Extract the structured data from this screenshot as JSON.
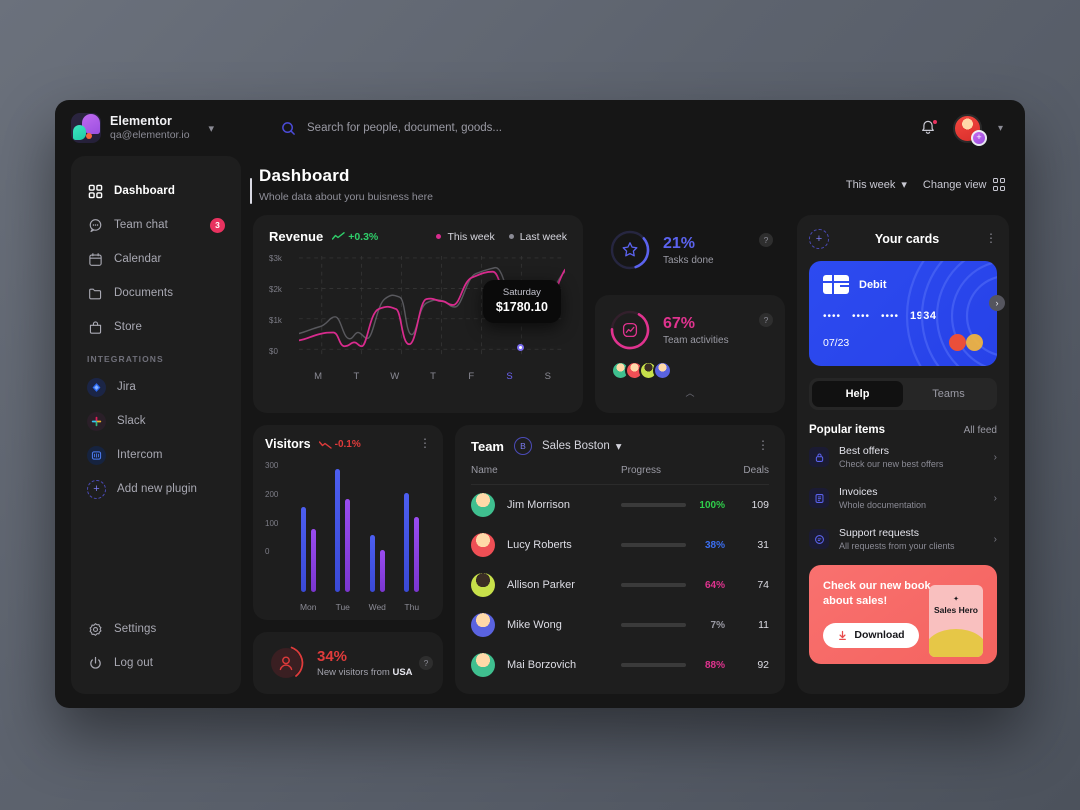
{
  "brand": {
    "name": "Elementor",
    "email": "qa@elementor.io",
    "caret": "▾"
  },
  "search": {
    "placeholder": "Search for people, document, goods...",
    "value": "",
    "icon": "search-icon"
  },
  "topbar": {
    "bell_icon": "bell-icon",
    "avatar_badge": "+",
    "chevron": "▾"
  },
  "sidebar": {
    "items": [
      {
        "label": "Dashboard",
        "icon": "grid-icon",
        "badge": ""
      },
      {
        "label": "Team chat",
        "icon": "chat-icon",
        "badge": "3"
      },
      {
        "label": "Calendar",
        "icon": "calendar-icon",
        "badge": ""
      },
      {
        "label": "Documents",
        "icon": "folder-icon",
        "badge": ""
      },
      {
        "label": "Store",
        "icon": "bag-icon",
        "badge": ""
      }
    ],
    "section_title": "INTEGRATIONS",
    "integrations": [
      {
        "label": "Jira",
        "icon": "jira-icon"
      },
      {
        "label": "Slack",
        "icon": "slack-icon"
      },
      {
        "label": "Intercom",
        "icon": "intercom-icon"
      },
      {
        "label": "Add new plugin",
        "icon": "plus-icon"
      }
    ],
    "bottom": [
      {
        "label": "Settings",
        "icon": "gear-icon"
      },
      {
        "label": "Log out",
        "icon": "power-icon"
      }
    ]
  },
  "main": {
    "title": "Dashboard",
    "subtitle": "Whole data about yoru buisness here",
    "period": "This week",
    "period_caret": "▾",
    "change_view": "Change view"
  },
  "revenue": {
    "title": "Revenue",
    "delta": "+0.3%",
    "delta_color": "#2fcf6a",
    "legend": [
      {
        "label": "This week",
        "color": "#d92b8e"
      },
      {
        "label": "Last week",
        "color": "#8a8a94"
      }
    ],
    "tooltip": {
      "day": "Saturday",
      "value": "$1780.10"
    },
    "chart_data": {
      "type": "line",
      "title": "Revenue",
      "x": [
        "M",
        "T",
        "W",
        "T",
        "F",
        "S",
        "S"
      ],
      "ylabel": "",
      "ytick_labels": [
        "$3k",
        "$2k",
        "$1k",
        "$0"
      ],
      "ylim": [
        0,
        3000
      ],
      "highlight_x": "S",
      "series": [
        {
          "name": "This week",
          "color": "#d92b8e",
          "values": [
            480,
            900,
            250,
            1850,
            1050,
            2350,
            2280,
            2900,
            3050,
            1780,
            2950
          ]
        },
        {
          "name": "Last week",
          "color": "#8a8a94",
          "values": [
            900,
            1700,
            2450,
            1950,
            2150,
            2450,
            1400,
            1150,
            1600,
            200,
            1100
          ]
        }
      ],
      "grid": true,
      "legend_position": "top-right"
    }
  },
  "stats": [
    {
      "value": "21%",
      "label": "Tasks done",
      "color": "#5b63ef",
      "ring_pct": 21,
      "icon": "star-icon",
      "help": "?"
    },
    {
      "value": "67%",
      "label": "Team activities",
      "color": "#e0338f",
      "ring_pct": 67,
      "icon": "activity-icon",
      "help": "?"
    }
  ],
  "team_activity_avatars": [
    "#3fbf8f",
    "#ef4f55",
    "#c7e04a",
    "#5a63e0"
  ],
  "collapse_arrow": "︿",
  "visitors": {
    "title": "Visitors",
    "delta": "-0.1%",
    "delta_color": "#e03b3b",
    "kebab": "⋮",
    "chart_data": {
      "type": "bar",
      "title": "Visitors",
      "categories": [
        "Mon",
        "Tue",
        "Wed",
        "Thu"
      ],
      "ytick_labels": [
        "300",
        "200",
        "100",
        "0"
      ],
      "ylim": [
        0,
        300
      ],
      "grid": true,
      "series": [
        {
          "name": "Series A",
          "color": "#4c5ef0",
          "values": [
            200,
            290,
            135,
            235
          ]
        },
        {
          "name": "Series B",
          "color": "#9a4cf0",
          "values": [
            150,
            220,
            98,
            178
          ]
        }
      ]
    }
  },
  "usa_card": {
    "value": "34%",
    "label_prefix": "New visitors from ",
    "label_strong": "USA",
    "color": "#e03b3b",
    "ring_pct": 34,
    "icon": "user-icon",
    "help": "?"
  },
  "team": {
    "title": "Team",
    "chip": "B",
    "selector": "Sales Boston",
    "selector_caret": "▾",
    "kebab": "⋮",
    "columns": [
      "Name",
      "Progress",
      "Deals"
    ],
    "rows": [
      {
        "name": "Jim Morrison",
        "pct": "100%",
        "pct_value": 100,
        "color": "#2fcf4a",
        "deals": "109",
        "avatar": "#3fbf8f"
      },
      {
        "name": "Lucy Roberts",
        "pct": "38%",
        "pct_value": 38,
        "color": "#3b4ef0",
        "deals": "31",
        "avatar": "#ef4f55"
      },
      {
        "name": "Allison Parker",
        "pct": "64%",
        "pct_value": 64,
        "color": "#e0338f",
        "deals": "74",
        "avatar": "#c7e04a"
      },
      {
        "name": "Mike Wong",
        "pct": "7%",
        "pct_value": 7,
        "color": "#9a9aa4",
        "deals": "11",
        "avatar": "#5a63e0"
      },
      {
        "name": "Mai Borzovich",
        "pct": "88%",
        "pct_value": 88,
        "color": "#e0338f",
        "deals": "92",
        "avatar": "#3fbf8f"
      }
    ]
  },
  "cards_panel": {
    "plus": "+",
    "title": "Your cards",
    "kebab": "⋮",
    "credit_card": {
      "type_label": "Debit",
      "masked_groups": [
        "••••",
        "••••",
        "••••"
      ],
      "last4": "1934",
      "expiry": "07/23",
      "brand_icon": "mastercard-icon",
      "bg": "#2d4bf0"
    },
    "next_arrow": "›",
    "tabs": [
      {
        "label": "Help",
        "active": true
      },
      {
        "label": "Teams",
        "active": false
      }
    ],
    "popular": {
      "title": "Popular items",
      "all_feed": "All feed",
      "items": [
        {
          "title": "Best offers",
          "subtitle": "Check our new best offers",
          "icon": "lock-icon",
          "chevron": "›"
        },
        {
          "title": "Invoices",
          "subtitle": "Whole documentation",
          "icon": "invoice-icon",
          "chevron": "›"
        },
        {
          "title": "Support requests",
          "subtitle": "All requests from your clients",
          "icon": "support-icon",
          "chevron": "›"
        }
      ]
    },
    "promo": {
      "text": "Check our new book about sales!",
      "button": "Download",
      "button_icon": "download-icon",
      "book_title": "Sales Hero",
      "bg": "#f4635f"
    }
  }
}
